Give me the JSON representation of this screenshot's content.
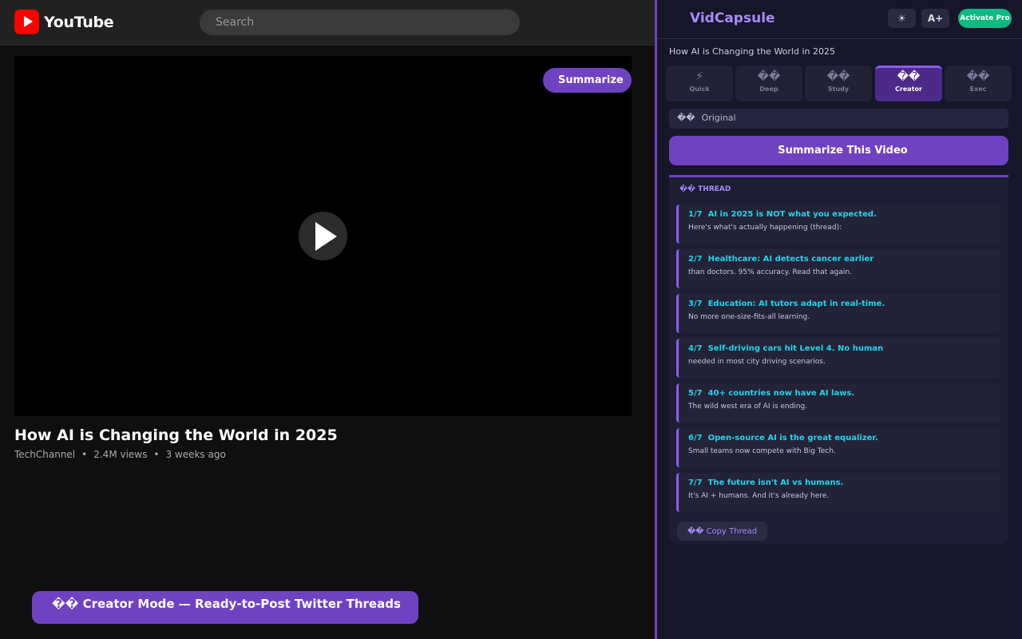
{
  "youtube": {
    "logo_text": "YouTube",
    "search_placeholder": "Search",
    "overlay_button_icon": "",
    "overlay_button_label": "Summarize",
    "video_title": "How AI is Changing the World in 2025",
    "channel": "TechChannel",
    "views": "2.4M views",
    "age": "3 weeks ago",
    "separator": "•",
    "creator_banner": "�� Creator Mode — Ready-to-Post Twitter Threads"
  },
  "vidcapsule": {
    "brand_icon": "",
    "brand": "VidCapsule",
    "theme_button": "☀",
    "font_button": "A+",
    "activate_button": "Activate Pro",
    "video_title": "How AI is Changing the World in 2025",
    "tabs": [
      {
        "icon": "⚡",
        "label": "Quick"
      },
      {
        "icon": "��",
        "label": "Deep"
      },
      {
        "icon": "��",
        "label": "Study"
      },
      {
        "icon": "��",
        "label": "Creator"
      },
      {
        "icon": "��",
        "label": "Exec"
      }
    ],
    "active_tab": "Creator",
    "language_icon": "��",
    "language": "Original",
    "summarize_icon": "",
    "summarize_label": "Summarize This Video",
    "thread_label": "�� THREAD",
    "tweets": [
      {
        "num": "1/7",
        "headline": "AI in 2025 is NOT what you expected.",
        "body": "Here's what's actually happening (thread):"
      },
      {
        "num": "2/7",
        "headline": "Healthcare: AI detects cancer earlier",
        "body": "than doctors. 95% accuracy. Read that again."
      },
      {
        "num": "3/7",
        "headline": "Education: AI tutors adapt in real-time.",
        "body": "No more one-size-fits-all learning."
      },
      {
        "num": "4/7",
        "headline": "Self-driving cars hit Level 4. No human",
        "body": "needed in most city driving scenarios."
      },
      {
        "num": "5/7",
        "headline": "40+ countries now have AI laws.",
        "body": "The wild west era of AI is ending."
      },
      {
        "num": "6/7",
        "headline": "Open-source AI is the great equalizer.",
        "body": "Small teams now compete with Big Tech."
      },
      {
        "num": "7/7",
        "headline": "The future isn't AI vs humans.",
        "body": "It's AI + humans. And it's already here."
      }
    ],
    "copy_button": "�� Copy Thread"
  },
  "colors": {
    "accent": "#6f42c1",
    "accent_light": "#a78bfa",
    "tweet_headline": "#22d3ee",
    "activate": "#10b981",
    "youtube_red": "#ff0000"
  }
}
